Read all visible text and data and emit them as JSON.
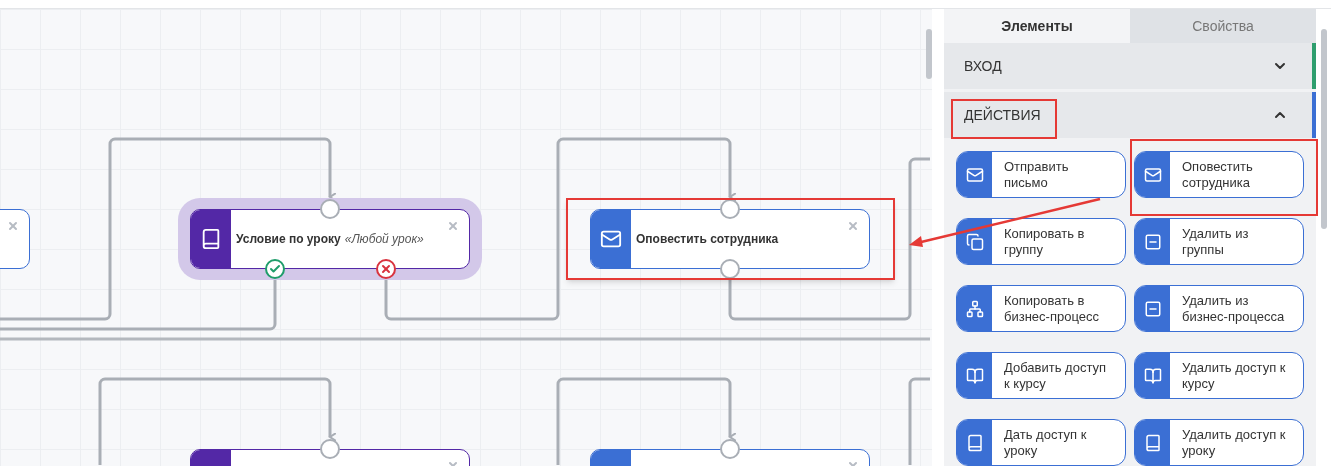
{
  "canvas": {
    "nodes": [
      {
        "kind": "action",
        "selected": false
      },
      {
        "kind": "condition",
        "title": "Условие по уроку",
        "subtitle": "«Любой урок»",
        "selected": true
      },
      {
        "kind": "action",
        "title": "Оповестить сотрудника",
        "selected": false
      },
      {
        "kind": "condition",
        "selected": false
      },
      {
        "kind": "action",
        "selected": false
      }
    ]
  },
  "sidebar": {
    "tabs": [
      {
        "label": "Элементы",
        "selected": true
      },
      {
        "label": "Свойства",
        "selected": false
      }
    ],
    "sections": [
      {
        "title": "ВХОД",
        "expanded": false,
        "color": "#2e9e6e"
      },
      {
        "title": "ДЕЙСТВИЯ",
        "expanded": true,
        "color": "#3b6fd4",
        "items": [
          {
            "kind": "mail",
            "label": "Отправить письмо"
          },
          {
            "kind": "mail",
            "label": "Оповестить сотрудника"
          },
          {
            "kind": "copy",
            "label": "Копировать в группу"
          },
          {
            "kind": "remove",
            "label": "Удалить из группы"
          },
          {
            "kind": "tree",
            "label": "Копировать в бизнес-процесс"
          },
          {
            "kind": "remove",
            "label": "Удалить из бизнес-процесса"
          },
          {
            "kind": "course",
            "label": "Добавить доступ к курсу"
          },
          {
            "kind": "course",
            "label": "Удалить доступ к курсу"
          },
          {
            "kind": "lesson",
            "label": "Дать доступ к уроку"
          },
          {
            "kind": "lesson",
            "label": "Удалить доступ к уроку"
          }
        ]
      }
    ]
  }
}
